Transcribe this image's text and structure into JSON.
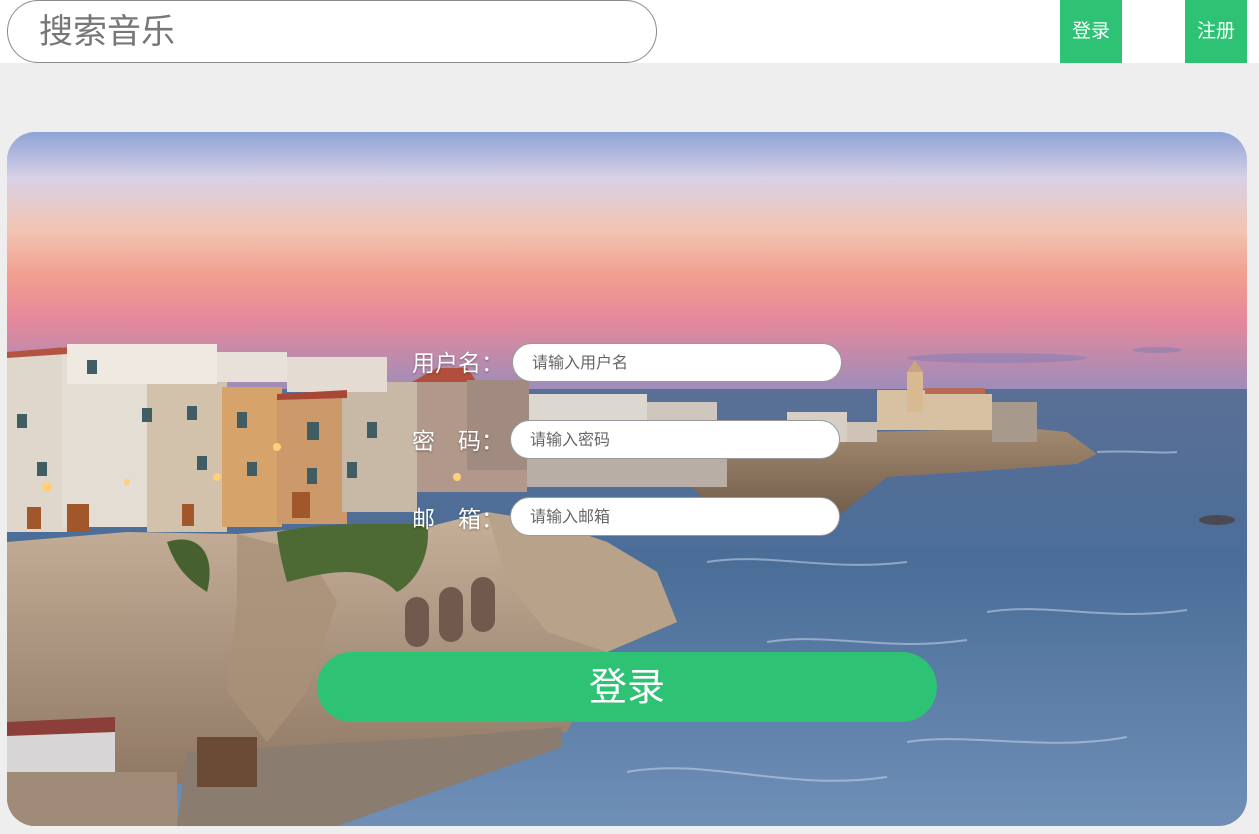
{
  "header": {
    "search": {
      "placeholder": "搜索音乐",
      "value": ""
    },
    "login_label": "登录",
    "register_label": "注册",
    "accent_color": "#2ec275"
  },
  "login_form": {
    "username": {
      "label": "用户名：",
      "placeholder": "请输入用户名"
    },
    "password": {
      "label": "密　码：",
      "placeholder": "请输入密码"
    },
    "email": {
      "label": "邮　箱：",
      "placeholder": "请输入邮箱"
    },
    "submit_label": "登录"
  },
  "background": {
    "description_icon": "coastal-town-sunset-image"
  }
}
